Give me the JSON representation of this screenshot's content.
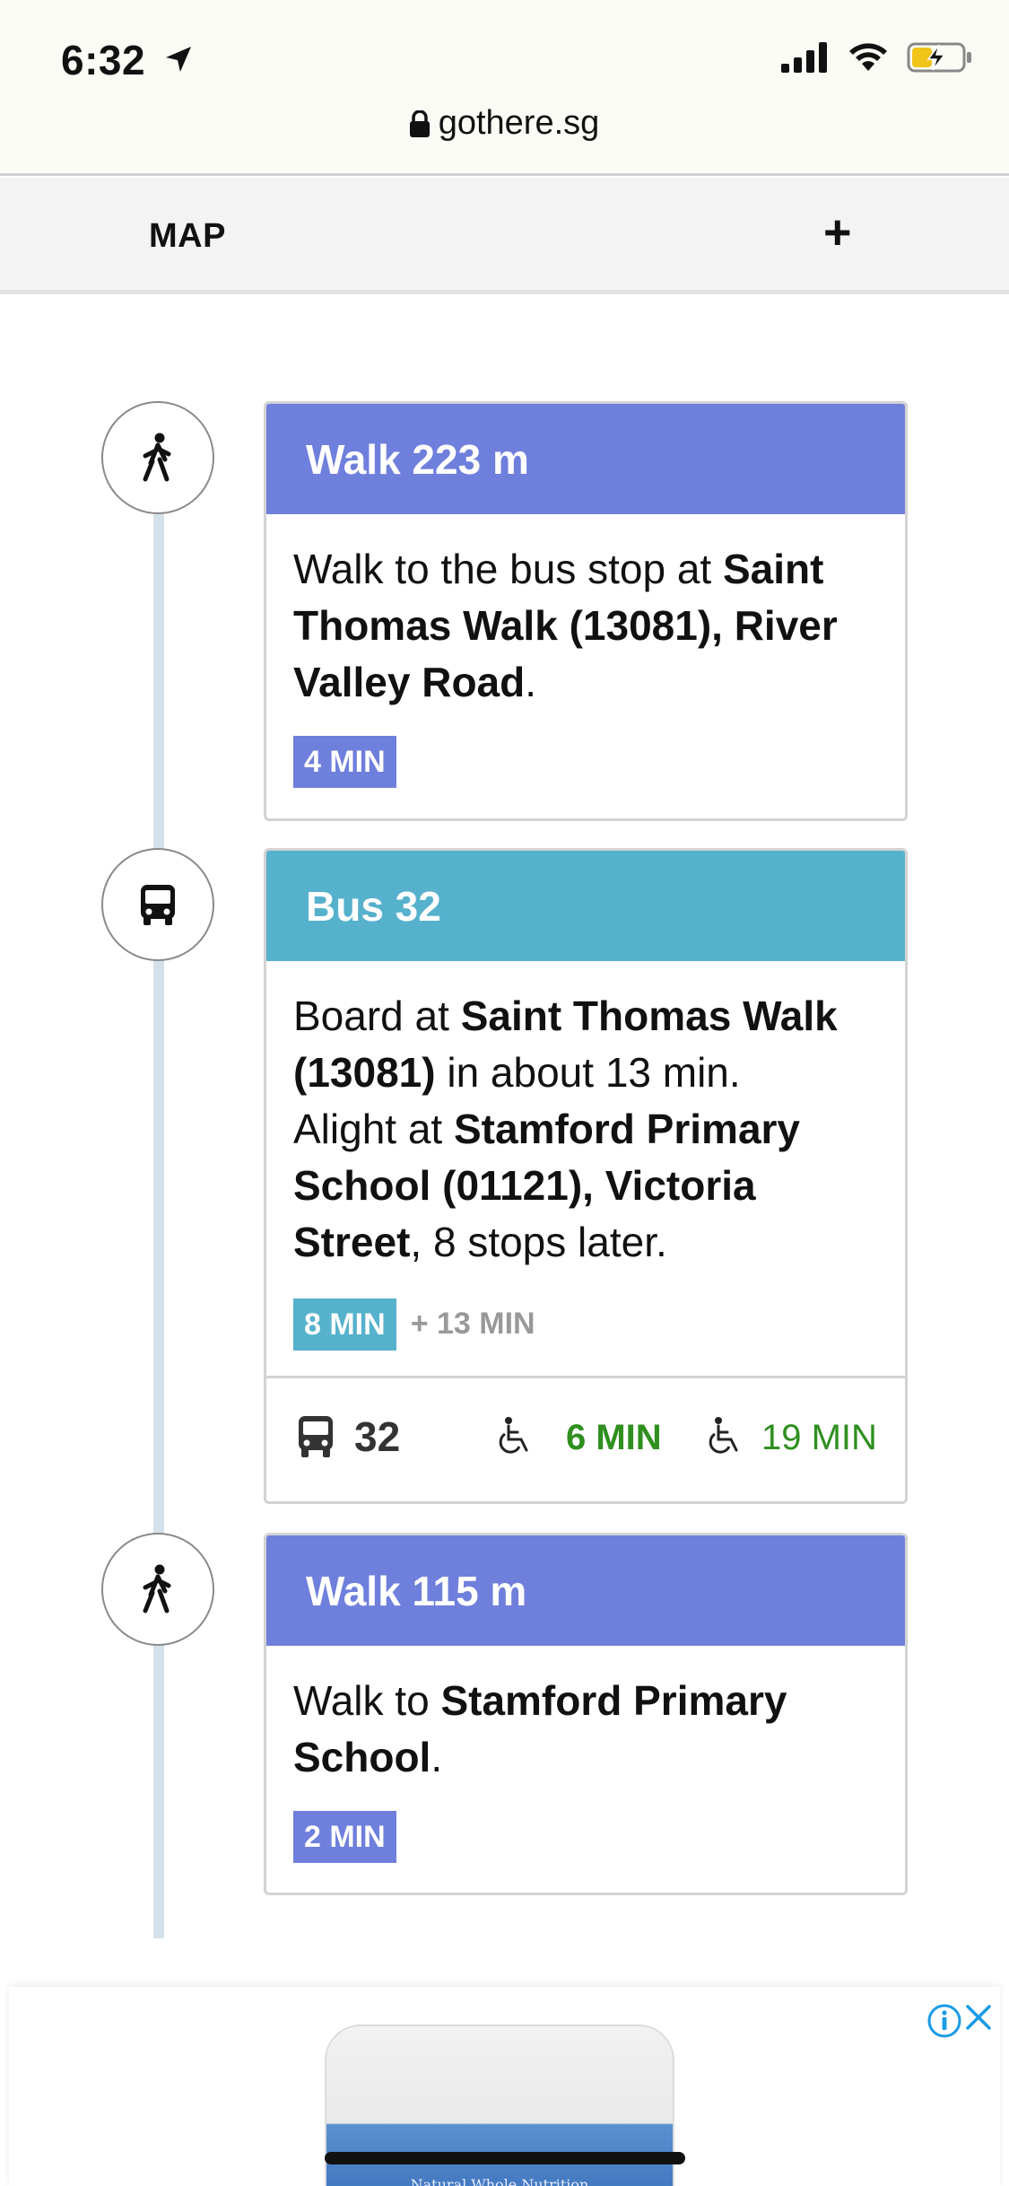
{
  "status_bar": {
    "time": "6:32",
    "icons": [
      "location-arrow-icon",
      "signal-icon",
      "wifi-icon",
      "battery-charging-icon"
    ]
  },
  "browser": {
    "url": "gothere.sg"
  },
  "map_bar": {
    "label": "MAP",
    "expand_label": "+"
  },
  "steps": [
    {
      "mode": "walk",
      "icon": "walking-person-icon",
      "title": "Walk 223 m",
      "body": {
        "prefix": "Walk to the bus stop at ",
        "bold": "Saint Thomas Walk (13081), River Valley Road",
        "suffix": "."
      },
      "duration": "4 MIN"
    },
    {
      "mode": "bus",
      "icon": "bus-icon",
      "title": "Bus 32",
      "body": {
        "board_prefix": "Board at ",
        "board_stop": "Saint Thomas Walk (13081)",
        "board_suffix": " in about 13 min.",
        "alight_prefix": "Alight at ",
        "alight_stop": "Stamford Primary School (01121), Victoria Street",
        "alight_suffix": ", 8 stops later."
      },
      "duration": "8 MIN",
      "wait": "+ 13 MIN",
      "arrivals": {
        "route": "32",
        "next": "6 MIN",
        "following": "19 MIN"
      }
    },
    {
      "mode": "walk",
      "icon": "walking-person-icon",
      "title": "Walk 115 m",
      "body": {
        "prefix": "Walk to ",
        "bold": "Stamford Primary School",
        "suffix": "."
      },
      "duration": "2 MIN"
    }
  ],
  "ad": {
    "product_text": "Natural Whole Nutrition",
    "icons": [
      "info-icon",
      "close-icon"
    ]
  },
  "colors": {
    "walk": "#6f7fdc",
    "bus": "#56b1cc",
    "arrival_green": "#2f8f1f",
    "timeline": "#d4e1ea"
  }
}
